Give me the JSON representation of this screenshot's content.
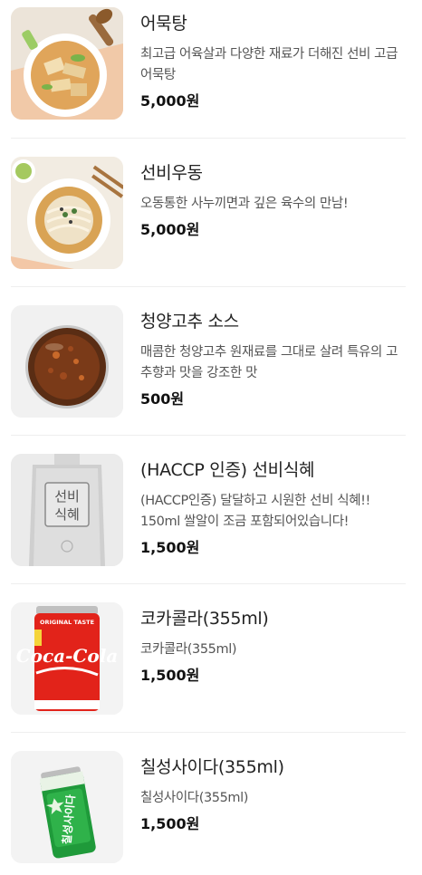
{
  "menu": {
    "items": [
      {
        "name": "어묵탕",
        "description": "최고급 어육살과 다양한 재료가 더해진 선비 고급 어묵탕",
        "price": "5,000원",
        "image_icon": "fishcake-soup-icon"
      },
      {
        "name": "선비우동",
        "description": "오동통한 사누끼면과 깊은 육수의 만남!",
        "price": "5,000원",
        "image_icon": "udon-icon"
      },
      {
        "name": "청양고추 소스",
        "description": "매콤한 청양고추 원재료를 그대로 살려 특유의 고추향과 맛을 강조한 맛",
        "price": "500원",
        "image_icon": "chili-sauce-icon"
      },
      {
        "name": "(HACCP 인증) 선비식혜",
        "description": "(HACCP인증) 달달하고 시원한 선비 식혜!! 150ml 쌀알이 조금 포함되어있습니다!",
        "price": "1,500원",
        "image_icon": "sikhye-pouch-icon",
        "image_text": "선비식혜"
      },
      {
        "name": "코카콜라(355ml)",
        "description": "코카콜라(355ml)",
        "price": "1,500원",
        "image_icon": "coca-cola-can-icon",
        "image_text": "Coca-Cola",
        "image_top_text": "ORIGINAL TASTE"
      },
      {
        "name": "칠성사이다(355ml)",
        "description": "칠성사이다(355ml)",
        "price": "1,500원",
        "image_icon": "chilsung-cider-can-icon",
        "image_text": "칠성사이다"
      }
    ]
  },
  "colors": {
    "text_primary": "#222222",
    "text_secondary": "#555555",
    "divider": "#eeeeee",
    "coke_red": "#e2231a",
    "cider_green": "#1f9a3a"
  }
}
